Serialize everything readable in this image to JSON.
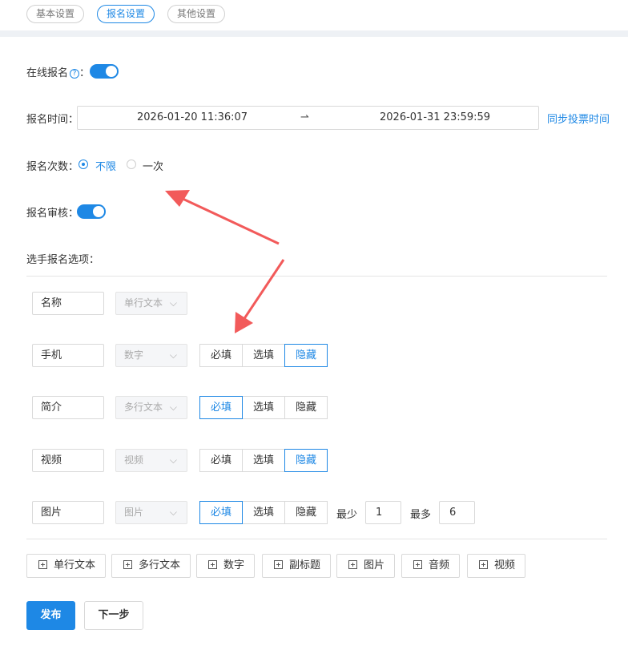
{
  "tabs": [
    {
      "label": "基本设置"
    },
    {
      "label": "报名设置"
    },
    {
      "label": "其他设置"
    }
  ],
  "active_tab": 1,
  "online_signup": {
    "label": "在线报名",
    "help": "?",
    "colon": "：",
    "enabled": true
  },
  "signup_time": {
    "label": "报名时间：",
    "start": "2026-01-20 11:36:07",
    "separator": "⇀",
    "end": "2026-01-31 23:59:59",
    "sync_link": "同步投票时间"
  },
  "signup_count": {
    "label": "报名次数：",
    "options": [
      {
        "label": "不限",
        "selected": true
      },
      {
        "label": "一次",
        "selected": false
      }
    ]
  },
  "signup_review": {
    "label": "报名审核：",
    "enabled": true
  },
  "fields_title": "选手报名选项：",
  "field_rows": [
    {
      "name": "名称",
      "type": "单行文本",
      "chevron": "⌵",
      "mode": null
    },
    {
      "name": "手机",
      "type": "数字",
      "chevron": "⌵",
      "mode": "隐藏"
    },
    {
      "name": "简介",
      "type": "多行文本",
      "chevron": "⌵",
      "mode": "必填"
    },
    {
      "name": "视频",
      "type": "视频",
      "chevron": "⌵",
      "mode": "隐藏"
    },
    {
      "name": "图片",
      "type": "图片",
      "chevron": "⌵",
      "mode": "必填",
      "min_label": "最少",
      "min": "1",
      "max_label": "最多",
      "max": "6"
    }
  ],
  "mode_options": [
    "必填",
    "选填",
    "隐藏"
  ],
  "add_buttons": [
    "单行文本",
    "多行文本",
    "数字",
    "副标题",
    "图片",
    "音频",
    "视频"
  ],
  "actions": {
    "publish": "发布",
    "next": "下一步"
  },
  "colors": {
    "accent": "#1e88e5",
    "arrow": "#f25a5a",
    "band": "#eef1f5"
  }
}
